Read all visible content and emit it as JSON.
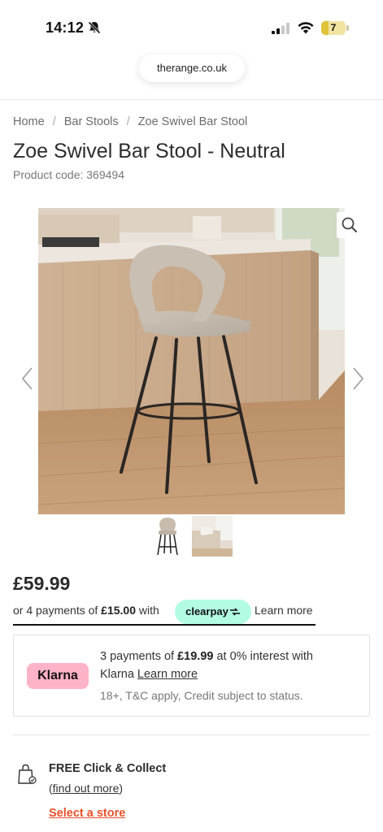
{
  "status_bar": {
    "time": "14:12",
    "battery_level": "7",
    "icons": [
      "bell-muted-icon",
      "cellular-signal-icon",
      "wifi-icon",
      "battery-icon"
    ]
  },
  "browser": {
    "url": "therange.co.uk"
  },
  "breadcrumb": {
    "items": [
      "Home",
      "Bar Stools",
      "Zoe Swivel Bar Stool"
    ],
    "separator": "/"
  },
  "product": {
    "title": "Zoe Swivel Bar Stool - Neutral",
    "code_text": "Product code: 369494",
    "price": "£59.99"
  },
  "gallery": {
    "icons": [
      "zoom-icon",
      "chevron-left-icon",
      "chevron-right-icon"
    ],
    "thumbnail_count": 2
  },
  "clearpay": {
    "prefix": "or 4 payments of ",
    "amount": "£15.00",
    "suffix": " with",
    "badge": "clearpay",
    "learn_more": "Learn more",
    "accent_color": "#b2fce4"
  },
  "klarna": {
    "badge": "Klarna",
    "line1_prefix": "3 payments of ",
    "line1_amount": "£19.99",
    "line1_suffix": " at 0% interest with",
    "line2_prefix": "Klarna",
    "line2_link": "Learn more",
    "line3": "18+, T&C apply, Credit subject to status.",
    "accent_color": "#ffb3c7"
  },
  "click_collect": {
    "title": "FREE Click & Collect",
    "find_out_more_open": "(",
    "find_out_more": "find out more",
    "find_out_more_close": ")",
    "select_store": "Select a store",
    "link_color": "#e8502a"
  }
}
